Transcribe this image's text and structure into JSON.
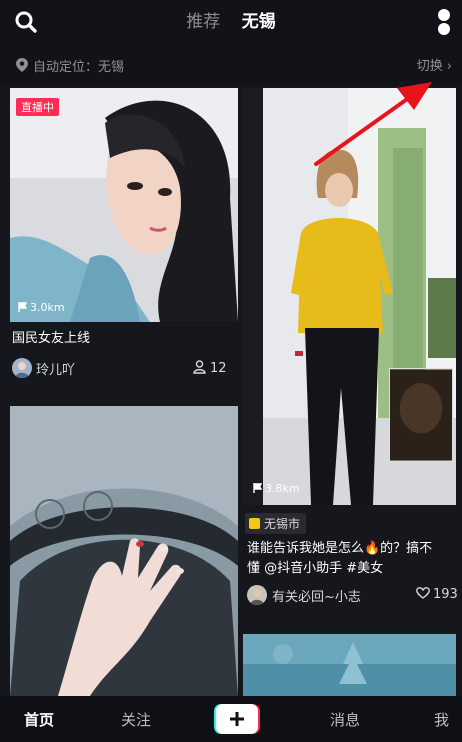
{
  "header": {
    "tabs": [
      {
        "label": "推荐",
        "active": false
      },
      {
        "label": "无锡",
        "active": true
      }
    ]
  },
  "location": {
    "label": "自动定位：无锡",
    "switch_label": "切换"
  },
  "cards": [
    {
      "badge": "直播中",
      "distance": "3.0km",
      "title": "国民女友上线",
      "author": "玲儿吖",
      "viewers": "12"
    },
    {
      "distance": "3.8km",
      "city": "无锡市",
      "title_line1": "谁能告诉我她是怎么🔥的？搞不",
      "title_line2": "懂 @抖音小助手 #美女",
      "author": "有关必回~小志",
      "likes": "193"
    },
    {},
    {}
  ],
  "bottom_nav": {
    "items": [
      {
        "label": "首页",
        "active": true
      },
      {
        "label": "关注",
        "active": false
      },
      {
        "label": "消息",
        "active": false
      },
      {
        "label": "我",
        "active": false
      }
    ]
  },
  "colors": {
    "accent_live": "#fe2c55",
    "annotation_arrow": "#e8141c",
    "background": "#121319"
  }
}
